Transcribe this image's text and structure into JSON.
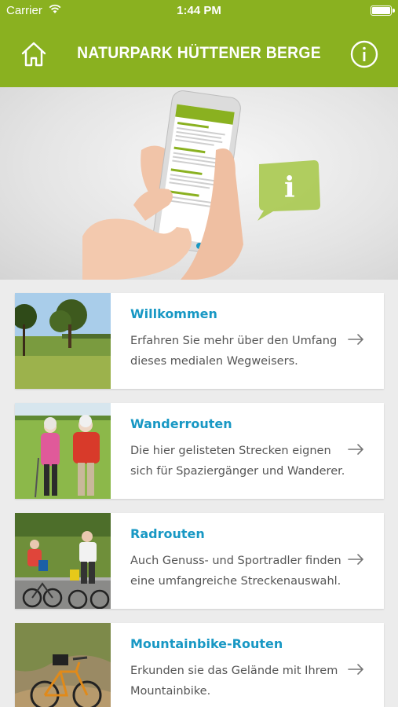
{
  "status_bar": {
    "carrier": "Carrier",
    "time": "1:44 PM"
  },
  "header": {
    "title": "NATURPARK HÜTTENER BERGE"
  },
  "colors": {
    "brand_green": "#8ab120",
    "link_blue": "#1898c4",
    "text_gray": "#555555"
  },
  "hero": {
    "speech_bubble_letter": "i",
    "slides_count": 3,
    "active_slide": 1
  },
  "cards": [
    {
      "title": "Willkommen",
      "desc_line1": "Erfahren Sie mehr über den Umfang",
      "desc_line2": "dieses medialen Wegweisers.",
      "icon": "arrow-right-icon"
    },
    {
      "title": "Wanderrouten",
      "desc_line1": "Die hier gelisteten Strecken eignen",
      "desc_line2": "sich für Spaziergänger und Wanderer.",
      "icon": "arrow-right-icon"
    },
    {
      "title": "Radrouten",
      "desc_line1": "Auch Genuss- und Sportradler finden",
      "desc_line2": "eine umfangreiche Streckenauswahl.",
      "icon": "arrow-right-icon"
    },
    {
      "title": "Mountainbike-Routen",
      "desc_line1": "Erkunden sie das Gelände mit Ihrem",
      "desc_line2": "Mountainbike.",
      "icon": "arrow-right-icon"
    }
  ]
}
